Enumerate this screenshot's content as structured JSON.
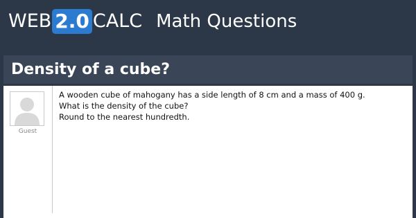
{
  "header": {
    "logo": {
      "web": "WEB",
      "version": "2.0",
      "calc": "CALC"
    },
    "section": "Math Questions"
  },
  "question": {
    "title": "Density of a cube?",
    "author": "Guest",
    "body_lines": [
      "A wooden cube of mahogany has a side length of 8 cm and a mass of 400 g.",
      "What is the density of the cube?",
      "Round to the nearest hundredth."
    ]
  },
  "colors": {
    "header_background": "#2c3848",
    "title_bar_background": "#3a4657",
    "logo_badge": "#2b7bd0"
  },
  "icons": {
    "avatar": "default-user-avatar-icon"
  }
}
